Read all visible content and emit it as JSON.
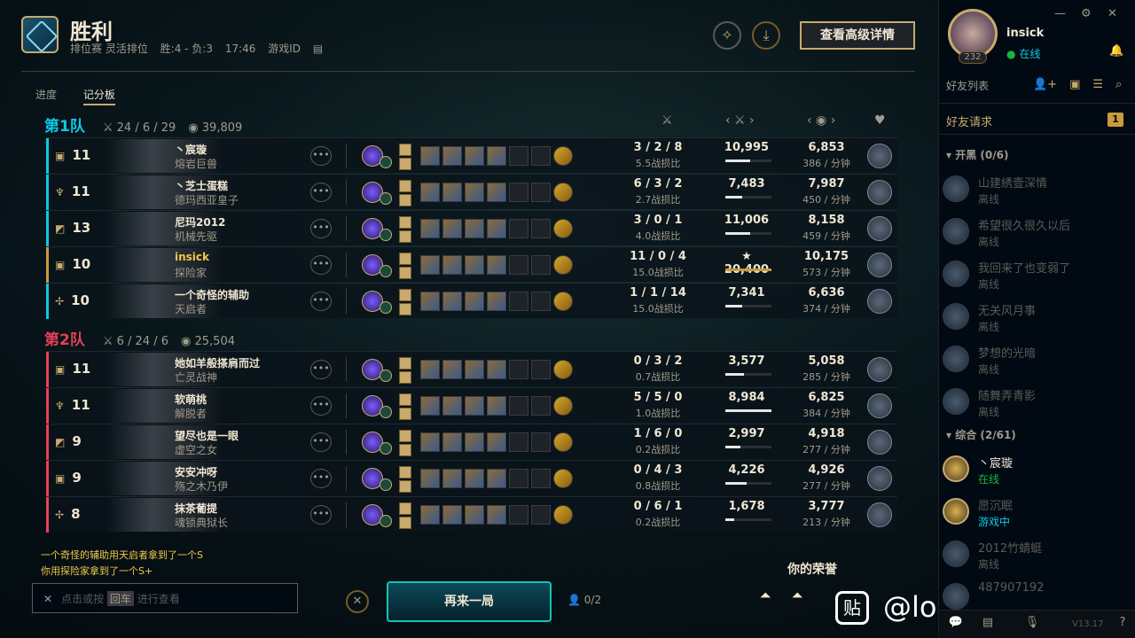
{
  "header": {
    "title": "胜利",
    "mode": "排位赛 灵活排位",
    "record": "胜:4 - 负:3",
    "duration": "17:46",
    "game_id_label": "游戏ID",
    "details_button": "查看高级详情"
  },
  "tabs": [
    "进度",
    "记分板"
  ],
  "teams": [
    {
      "name": "第1队",
      "color": "#0acbe6",
      "kda": "24 / 6 / 29",
      "gold": "39,809",
      "players": [
        {
          "level": "11",
          "name": "丶宸璇",
          "champion": "熔岩巨兽",
          "kda": "3 / 2 / 8",
          "ratio": "5.5战损比",
          "damage": "10,995",
          "damage_pct": 0.54,
          "gold": "6,853",
          "gpm": "386 / 分钟"
        },
        {
          "level": "11",
          "name": "丶芝士蛋糕",
          "champion": "德玛西亚皇子",
          "kda": "6 / 3 / 2",
          "ratio": "2.7战损比",
          "damage": "7,483",
          "damage_pct": 0.37,
          "gold": "7,987",
          "gpm": "450 / 分钟"
        },
        {
          "level": "13",
          "name": "尼玛2012",
          "champion": "机械先驱",
          "kda": "3 / 0 / 1",
          "ratio": "4.0战损比",
          "damage": "11,006",
          "damage_pct": 0.54,
          "gold": "8,158",
          "gpm": "459 / 分钟"
        },
        {
          "level": "10",
          "name": "insick",
          "champion": "探险家",
          "kda": "11 / 0 / 4",
          "ratio": "15.0战损比",
          "damage": "★ 20,400",
          "damage_pct": 1.0,
          "gold": "10,175",
          "gpm": "573 / 分钟",
          "me": true
        },
        {
          "level": "10",
          "name": "一个奇怪的辅助",
          "champion": "天启者",
          "kda": "1 / 1 / 14",
          "ratio": "15.0战损比",
          "damage": "7,341",
          "damage_pct": 0.36,
          "gold": "6,636",
          "gpm": "374 / 分钟"
        }
      ]
    },
    {
      "name": "第2队",
      "color": "#e84057",
      "kda": "6 / 24 / 6",
      "gold": "25,504",
      "players": [
        {
          "level": "11",
          "name": "她如羊般搽肩而过",
          "champion": "亡灵战神",
          "kda": "0 / 3 / 2",
          "ratio": "0.7战损比",
          "damage": "3,577",
          "damage_pct": 0.4,
          "gold": "5,058",
          "gpm": "285 / 分钟"
        },
        {
          "level": "11",
          "name": "软萌桃",
          "champion": "解脱者",
          "kda": "5 / 5 / 0",
          "ratio": "1.0战损比",
          "damage": "8,984",
          "damage_pct": 1.0,
          "gold": "6,825",
          "gpm": "384 / 分钟"
        },
        {
          "level": "9",
          "name": "望尽也是一眼",
          "champion": "虚空之女",
          "kda": "1 / 6 / 0",
          "ratio": "0.2战损比",
          "damage": "2,997",
          "damage_pct": 0.33,
          "gold": "4,918",
          "gpm": "277 / 分钟"
        },
        {
          "level": "9",
          "name": "安安冲呀",
          "champion": "殇之木乃伊",
          "kda": "0 / 4 / 3",
          "ratio": "0.8战损比",
          "damage": "4,226",
          "damage_pct": 0.47,
          "gold": "4,926",
          "gpm": "277 / 分钟"
        },
        {
          "level": "8",
          "name": "抹茶葡提",
          "champion": "魂锁典狱长",
          "kda": "0 / 6 / 1",
          "ratio": "0.2战损比",
          "damage": "1,678",
          "damage_pct": 0.19,
          "gold": "3,777",
          "gpm": "213 / 分钟"
        }
      ]
    }
  ],
  "chat": {
    "messages": [
      "一个奇怪的辅助用天启者拿到了一个S",
      "你用探险家拿到了一个S+"
    ],
    "placeholder_pre": "点击或按",
    "placeholder_key": "回车",
    "placeholder_post": "进行查看"
  },
  "footer": {
    "play_again": "再来一局",
    "party": "0/2",
    "honor_title": "你的荣誉"
  },
  "watermark": "@lol代练价格表吧",
  "sidebar": {
    "username": "insick",
    "status": "在线",
    "level": "232",
    "friends_label": "好友列表",
    "requests_label": "好友请求",
    "requests_count": "1",
    "group1": "开黑 (0/6)",
    "group2": "综合 (2/61)",
    "version": "V13.17",
    "offline_friends": [
      {
        "name": "山建綉壹深情",
        "status": "离线"
      },
      {
        "name": "希望很久很久以后",
        "status": "离线"
      },
      {
        "name": "我回来了也变弱了",
        "status": "离线"
      },
      {
        "name": "无关风月事",
        "status": "离线"
      },
      {
        "name": "梦想的光暗",
        "status": "离线"
      },
      {
        "name": "随舞弄青影",
        "status": "离线"
      }
    ],
    "group2_friends": [
      {
        "name": "丶宸璇",
        "status": "在线"
      },
      {
        "name": "愿沉眠",
        "status": "游戏中"
      },
      {
        "name": "2012竹蜻蜓",
        "status": "离线"
      },
      {
        "name": "487907192",
        "status": ""
      }
    ]
  }
}
